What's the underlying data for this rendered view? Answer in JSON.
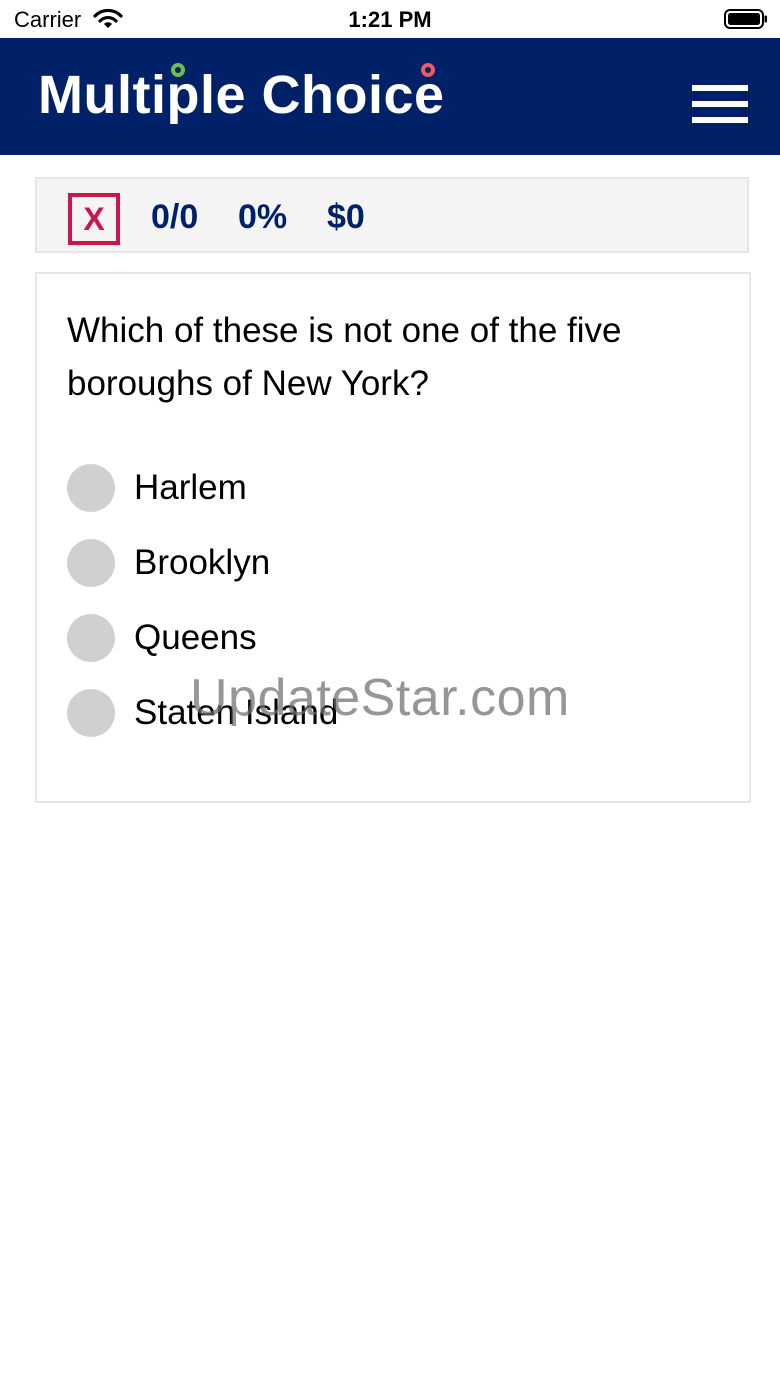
{
  "status_bar": {
    "carrier": "Carrier",
    "time": "1:21 PM"
  },
  "header": {
    "title": "Multiple Choice",
    "background_color": "#002068",
    "menu_icon": "hamburger-menu-icon"
  },
  "score_bar": {
    "quit_label": "X",
    "answered": "0/0",
    "percent": "0%",
    "money": "$0",
    "accent_color": "#c8174a",
    "text_color": "#002068"
  },
  "question": {
    "text": "Which of these is not one of the five boroughs of New York?",
    "answers": [
      {
        "label": "Harlem"
      },
      {
        "label": "Brooklyn"
      },
      {
        "label": "Queens"
      },
      {
        "label": "Staten Island"
      }
    ]
  },
  "watermark": "UpdateStar.com"
}
